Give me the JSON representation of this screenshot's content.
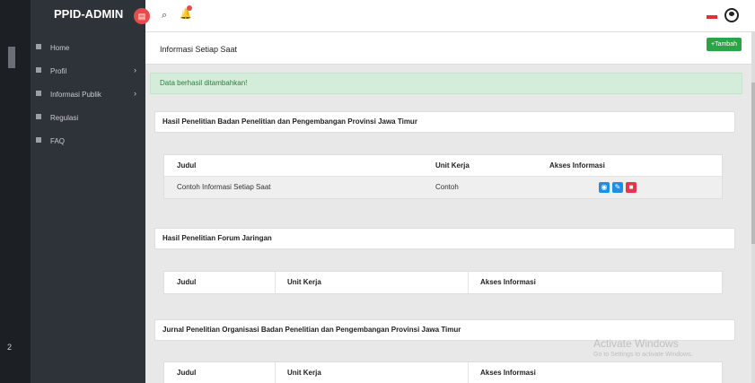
{
  "leftstrip": {
    "numbers": [
      "2"
    ]
  },
  "sidebar": {
    "brand": "PPID-ADMIN",
    "items": [
      {
        "label": "Home",
        "icon": "home-icon",
        "has_arrow": false
      },
      {
        "label": "Profil",
        "icon": "user-icon",
        "has_arrow": true
      },
      {
        "label": "Informasi Publik",
        "icon": "folder-icon",
        "has_arrow": true
      },
      {
        "label": "Regulasi",
        "icon": "folder-icon",
        "has_arrow": false
      },
      {
        "label": "FAQ",
        "icon": "comments-icon",
        "has_arrow": false
      }
    ],
    "arrow_glyph": "›"
  },
  "topbar": {
    "search_glyph": "⌕",
    "bell_glyph": "🔔"
  },
  "page": {
    "title": "Informasi Setiap Saat",
    "add_button": "+Tambah"
  },
  "alert": {
    "text": "Data berhasil ditambahkan!"
  },
  "sections": [
    {
      "title": "Hasil Penelitian Badan Penelitian dan Pengembangan Provinsi Jawa Timur",
      "columns": [
        "Judul",
        "Unit Kerja",
        "Akses Informasi"
      ],
      "rows": [
        {
          "judul": "Contoh Informasi Setiap Saat",
          "unit_kerja": "Contoh"
        }
      ]
    },
    {
      "title": "Hasil Penelitian Forum Jaringan",
      "columns": [
        "Judul",
        "Unit Kerja",
        "Akses Informasi"
      ],
      "rows": []
    },
    {
      "title": "Jurnal Penelitian Organisasi Badan Penelitian dan Pengembangan Provinsi Jawa Timur",
      "columns": [
        "Judul",
        "Unit Kerja",
        "Akses Informasi"
      ],
      "rows": []
    }
  ],
  "actions": {
    "view_glyph": "◉",
    "edit_glyph": "✎",
    "delete_glyph": "■"
  },
  "watermark": {
    "line1": "Activate Windows",
    "line2": "Go to Settings to activate Windows."
  },
  "colors": {
    "sidebar_bg": "#2e3239",
    "success": "#29a547",
    "primary": "#1e8fe8",
    "danger": "#e5364b",
    "alert_bg": "#d4edda"
  }
}
